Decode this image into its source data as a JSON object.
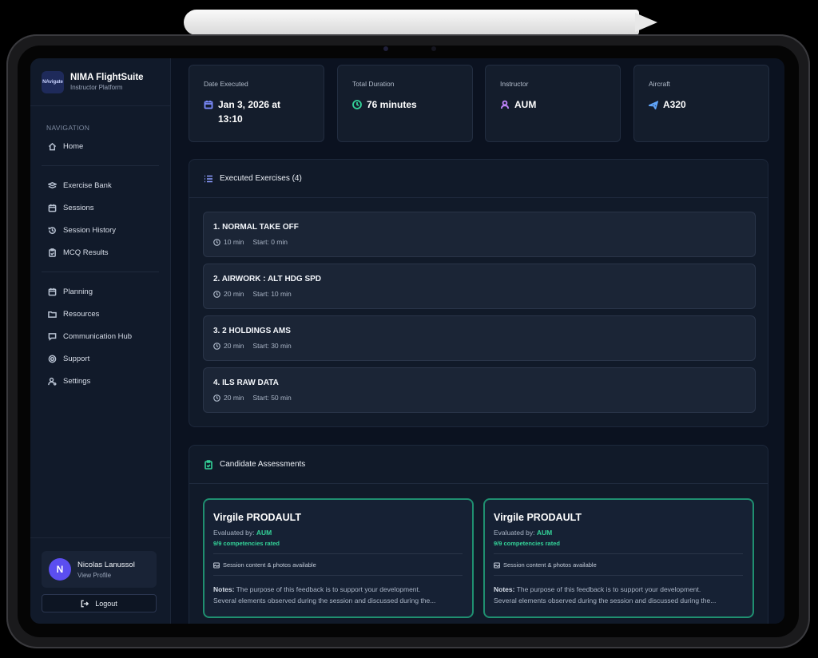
{
  "brand": {
    "logo_text": "NAvigate",
    "title": "NIMA FlightSuite",
    "subtitle": "Instructor Platform"
  },
  "sidebar": {
    "section_label": "NAVIGATION",
    "home": "Home",
    "group1": [
      "Exercise Bank",
      "Sessions",
      "Session History",
      "MCQ Results"
    ],
    "group2": [
      "Planning",
      "Resources",
      "Communication Hub",
      "Support",
      "Settings"
    ]
  },
  "profile": {
    "initial": "N",
    "name": "Nicolas Lanussol",
    "link": "View Profile",
    "logout": "Logout"
  },
  "stats": [
    {
      "label": "Date Executed",
      "value": "Jan 3, 2026 at 13:10",
      "icon": "calendar-icon",
      "color": "#7c8cff"
    },
    {
      "label": "Total Duration",
      "value": "76 minutes",
      "icon": "clock-icon",
      "color": "#34d399"
    },
    {
      "label": "Instructor",
      "value": "AUM",
      "icon": "user-icon",
      "color": "#c084fc"
    },
    {
      "label": "Aircraft",
      "value": "A320",
      "icon": "plane-icon",
      "color": "#60a5fa"
    }
  ],
  "exercises": {
    "title": "Executed Exercises (4)",
    "items": [
      {
        "title": "1. NORMAL TAKE OFF",
        "duration": "10 min",
        "start": "Start: 0 min"
      },
      {
        "title": "2. AIRWORK : ALT HDG SPD",
        "duration": "20 min",
        "start": "Start: 10 min"
      },
      {
        "title": "3. 2 HOLDINGS AMS",
        "duration": "20 min",
        "start": "Start: 30 min"
      },
      {
        "title": "4. ILS RAW DATA",
        "duration": "20 min",
        "start": "Start: 50 min"
      }
    ]
  },
  "assessments": {
    "title": "Candidate Assessments",
    "cards": [
      {
        "name": "Virgile PRODAULT",
        "evaluated_label": "Evaluated by:",
        "evaluator": "AUM",
        "competencies": "9/9 competencies rated",
        "session": "Session content & photos available",
        "notes_label": "Notes:",
        "notes_line1": "The purpose of this feedback is to support your development.",
        "notes_line2": "Several elements observed during the session and discussed during the..."
      },
      {
        "name": "Virgile PRODAULT",
        "evaluated_label": "Evaluated by:",
        "evaluator": "AUM",
        "competencies": "9/9 competencies rated",
        "session": "Session content & photos available",
        "notes_label": "Notes:",
        "notes_line1": "The purpose of this feedback is to support your development.",
        "notes_line2": "Several elements observed during the session and discussed during the..."
      }
    ]
  },
  "colors": {
    "accent_green": "#34d399",
    "card_border_green": "#1f8f70",
    "avatar": "#5b4ef0"
  }
}
